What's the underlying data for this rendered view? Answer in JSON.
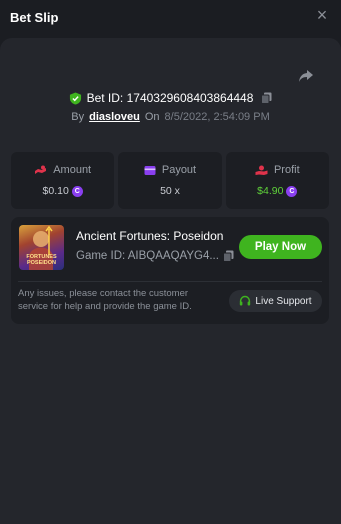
{
  "header": {
    "title": "Bet Slip",
    "close_glyph": "×"
  },
  "bet": {
    "id_label": "Bet ID: 1740329608403864448",
    "by_label": "By",
    "username": "diasloveu",
    "on_label": "On",
    "datetime": "8/5/2022, 2:54:09 PM"
  },
  "stats": {
    "amount": {
      "label": "Amount",
      "value": "$0.10",
      "icon": "amount-icon"
    },
    "payout": {
      "label": "Payout",
      "value": "50 x",
      "icon": "payout-icon"
    },
    "profit": {
      "label": "Profit",
      "value": "$4.90",
      "icon": "profit-icon"
    }
  },
  "game": {
    "thumb_text": "FORTUNES POSEIDON",
    "name": "Ancient Fortunes: Poseidon",
    "id": "Game ID: AIBQAAQAYG4...",
    "play_label": "Play Now"
  },
  "support": {
    "notice": "Any issues, please contact the customer service for help and provide the game ID.",
    "button_label": "Live Support"
  },
  "colors": {
    "accent_green": "#3fb41f",
    "profit_green": "#5fd13a",
    "coin_purple": "#8a3ff0",
    "amount_icon": "#e0334b",
    "payout_icon": "#8a3ff0",
    "profit_icon": "#e0334b"
  }
}
